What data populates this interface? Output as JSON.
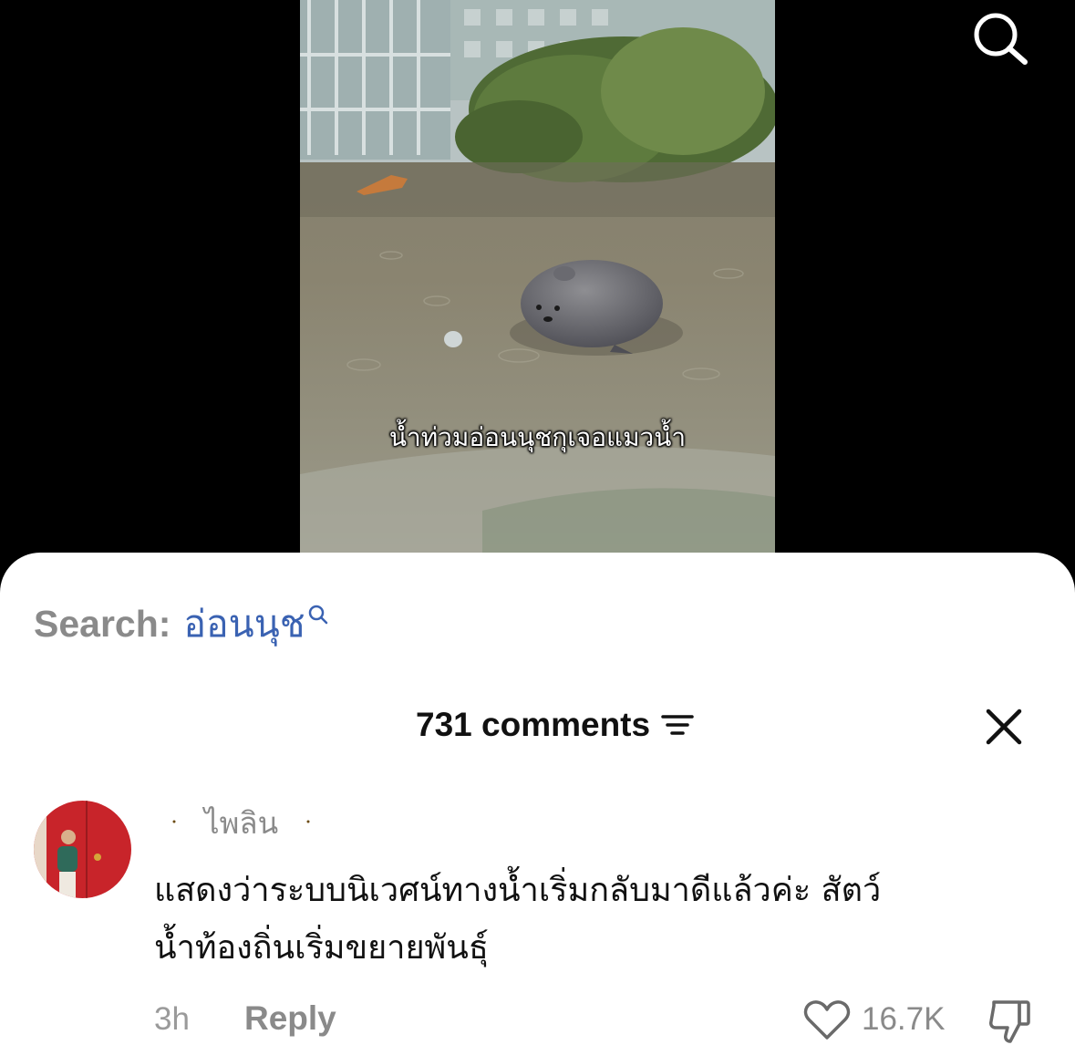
{
  "video": {
    "caption": "น้ำท่วมอ่อนนุชกุเจอแมวน้ำ",
    "description": "Flooded street with a grey seal plush floating in the water"
  },
  "top_bar": {
    "search_icon": "search-icon"
  },
  "search": {
    "prefix": "Search:",
    "term": "อ่อนนุช",
    "icon": "search-icon"
  },
  "comments_header": {
    "title": "731 comments",
    "sort_icon": "sort-icon",
    "close_icon": "close-icon"
  },
  "comment": {
    "username": "ไพลิน",
    "username_decoration": "moon-emoji",
    "avatar": "avatar",
    "text_line1": "แสดงว่าระบบนิเวศน์ทางน้ำเริ่มกลับมาดีแล้วค่ะ สัตว์",
    "text_line2": "น้ำท้องถิ่นเริ่มขยายพันธุ์",
    "time": "3h",
    "reply_label": "Reply",
    "like_count": "16.7K",
    "like_icon": "heart-icon",
    "dislike_icon": "thumbs-down-icon"
  },
  "colors": {
    "accent_link": "#3a62b2",
    "muted_text": "#8a8a8a",
    "primary_text": "#111111",
    "background_video": "#000000",
    "sheet": "#ffffff"
  }
}
